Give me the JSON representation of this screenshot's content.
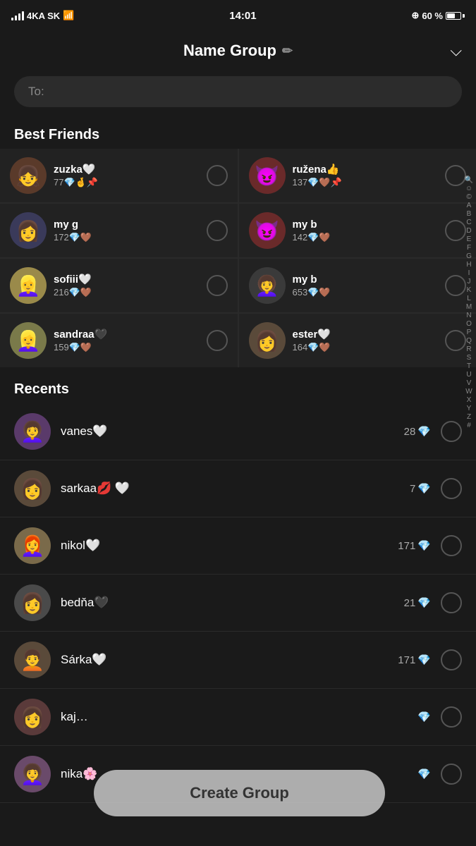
{
  "status": {
    "carrier": "4KA SK",
    "wifi": true,
    "time": "14:01",
    "location": "@",
    "battery_pct": "60 %"
  },
  "header": {
    "title": "Name Group",
    "edit_icon": "✏️",
    "chevron": "⌄"
  },
  "search": {
    "placeholder": "To:"
  },
  "best_friends": {
    "label": "Best Friends",
    "friends": [
      {
        "id": 1,
        "name": "zuzka🤍",
        "score": "77💎🤞📌",
        "avatar": "👧"
      },
      {
        "id": 2,
        "name": "ružena👍",
        "score": "137💎🤎📌",
        "avatar": "😈"
      },
      {
        "id": 3,
        "name": "my g",
        "score": "172💎🤎",
        "avatar": "👩"
      },
      {
        "id": 4,
        "name": "my b",
        "score": "142💎🤎",
        "avatar": "😈"
      },
      {
        "id": 5,
        "name": "sofiii🤍",
        "score": "216💎🤎",
        "avatar": "👱‍♀️"
      },
      {
        "id": 6,
        "name": "my b",
        "score": "653💎🤎",
        "avatar": "👩‍🦱"
      },
      {
        "id": 7,
        "name": "sandraa🖤",
        "score": "159💎🤎",
        "avatar": "👱‍♀️"
      },
      {
        "id": 8,
        "name": "ester🤍",
        "score": "164💎🤎",
        "avatar": "👩"
      }
    ]
  },
  "recents": {
    "label": "Recents",
    "items": [
      {
        "id": 1,
        "name": "vanes🤍",
        "score": "28💎",
        "avatar": "👩‍🦱"
      },
      {
        "id": 2,
        "name": "sarkaa💋 🤍",
        "score": "7💎",
        "avatar": "👩"
      },
      {
        "id": 3,
        "name": "nikol🤍",
        "score": "171💎",
        "avatar": "👩‍🦰"
      },
      {
        "id": 4,
        "name": "bedňa🖤",
        "score": "21💎",
        "avatar": "👩"
      },
      {
        "id": 5,
        "name": "Sárka🤍",
        "score": "171💎",
        "avatar": "🧑‍🦱"
      },
      {
        "id": 6,
        "name": "kaj…",
        "score": "💎",
        "avatar": "👩"
      },
      {
        "id": 7,
        "name": "nika🌸",
        "score": "💎",
        "avatar": "👩‍🦱"
      }
    ]
  },
  "alphabet": [
    "🔍",
    "☺",
    "©",
    "A",
    "B",
    "C",
    "D",
    "E",
    "F",
    "G",
    "H",
    "I",
    "J",
    "K",
    "L",
    "M",
    "N",
    "O",
    "P",
    "Q",
    "R",
    "S",
    "T",
    "U",
    "V",
    "W",
    "X",
    "Y",
    "Z",
    "#"
  ],
  "create_group": {
    "label": "Create Group"
  }
}
